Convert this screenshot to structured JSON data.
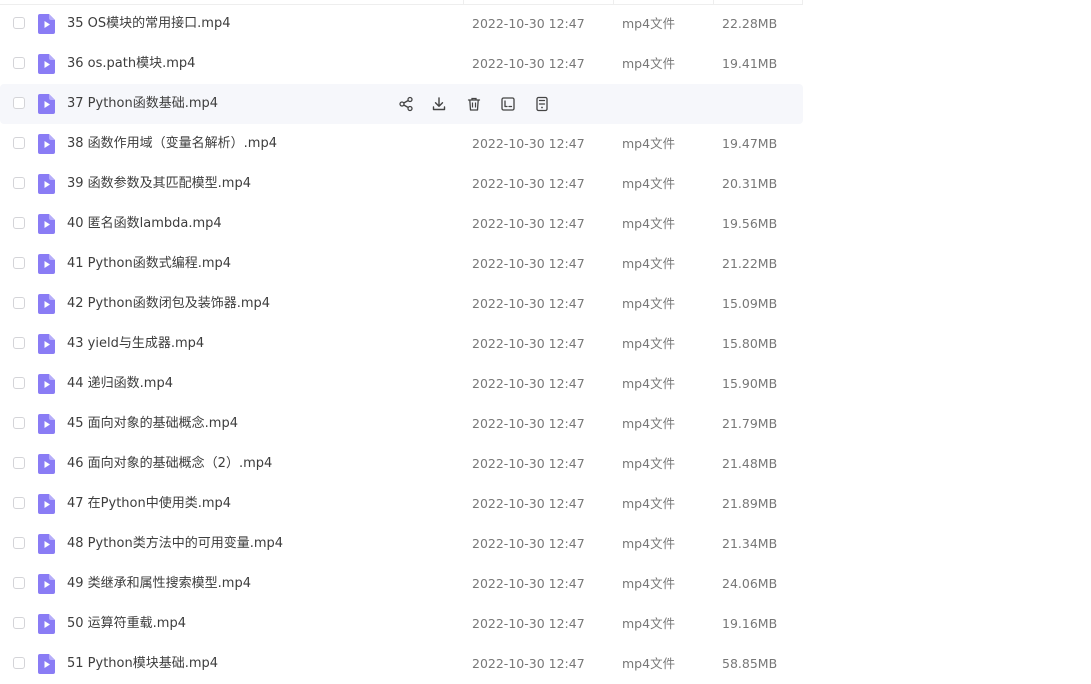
{
  "colors": {
    "accent": "#8a7cf5",
    "hover_row": "#f6f7fb",
    "text_primary": "#3d3d3d",
    "text_secondary": "#777777"
  },
  "file_list": {
    "hover_row_index": 2,
    "hover_actions": [
      {
        "icon": "share-icon"
      },
      {
        "icon": "download-icon"
      },
      {
        "icon": "delete-icon"
      },
      {
        "icon": "rename-icon"
      },
      {
        "icon": "more-icon"
      }
    ],
    "rows": [
      {
        "name": "35 OS模块的常用接口.mp4",
        "date": "2022-10-30 12:47",
        "type": "mp4文件",
        "size": "22.28MB"
      },
      {
        "name": "36 os.path模块.mp4",
        "date": "2022-10-30 12:47",
        "type": "mp4文件",
        "size": "19.41MB"
      },
      {
        "name": "37 Python函数基础.mp4",
        "date": "",
        "type": "",
        "size": ""
      },
      {
        "name": "38 函数作用域（变量名解析）.mp4",
        "date": "2022-10-30 12:47",
        "type": "mp4文件",
        "size": "19.47MB"
      },
      {
        "name": "39 函数参数及其匹配模型.mp4",
        "date": "2022-10-30 12:47",
        "type": "mp4文件",
        "size": "20.31MB"
      },
      {
        "name": "40 匿名函数lambda.mp4",
        "date": "2022-10-30 12:47",
        "type": "mp4文件",
        "size": "19.56MB"
      },
      {
        "name": "41 Python函数式编程.mp4",
        "date": "2022-10-30 12:47",
        "type": "mp4文件",
        "size": "21.22MB"
      },
      {
        "name": "42 Python函数闭包及装饰器.mp4",
        "date": "2022-10-30 12:47",
        "type": "mp4文件",
        "size": "15.09MB"
      },
      {
        "name": "43 yield与生成器.mp4",
        "date": "2022-10-30 12:47",
        "type": "mp4文件",
        "size": "15.80MB"
      },
      {
        "name": "44 递归函数.mp4",
        "date": "2022-10-30 12:47",
        "type": "mp4文件",
        "size": "15.90MB"
      },
      {
        "name": "45 面向对象的基础概念.mp4",
        "date": "2022-10-30 12:47",
        "type": "mp4文件",
        "size": "21.79MB"
      },
      {
        "name": "46 面向对象的基础概念（2）.mp4",
        "date": "2022-10-30 12:47",
        "type": "mp4文件",
        "size": "21.48MB"
      },
      {
        "name": "47 在Python中使用类.mp4",
        "date": "2022-10-30 12:47",
        "type": "mp4文件",
        "size": "21.89MB"
      },
      {
        "name": "48 Python类方法中的可用变量.mp4",
        "date": "2022-10-30 12:47",
        "type": "mp4文件",
        "size": "21.34MB"
      },
      {
        "name": "49 类继承和属性搜索模型.mp4",
        "date": "2022-10-30 12:47",
        "type": "mp4文件",
        "size": "24.06MB"
      },
      {
        "name": "50 运算符重载.mp4",
        "date": "2022-10-30 12:47",
        "type": "mp4文件",
        "size": "19.16MB"
      },
      {
        "name": "51 Python模块基础.mp4",
        "date": "2022-10-30 12:47",
        "type": "mp4文件",
        "size": "58.85MB"
      }
    ]
  }
}
